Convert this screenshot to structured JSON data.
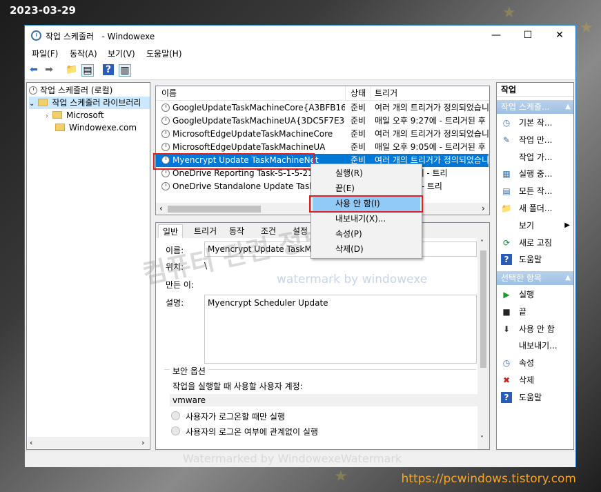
{
  "overlay": {
    "date": "2023-03-29",
    "url": "https://pcwindows.tistory.com"
  },
  "window": {
    "title": "작업 스케줄러",
    "subtitle": "- Windowexe",
    "minimize": "—",
    "maximize": "☐",
    "close": "✕"
  },
  "menu": [
    "파일(F)",
    "동작(A)",
    "보기(V)",
    "도움말(H)"
  ],
  "tree": {
    "root": "작업 스케줄러 (로컬)",
    "library": "작업 스케줄러 라이브러리",
    "children": [
      "Microsoft",
      "Windowexe.com"
    ]
  },
  "task_table": {
    "columns": [
      "이름",
      "상태",
      "트리거"
    ],
    "rows": [
      {
        "name": "GoogleUpdateTaskMachineCore{A3BFB16C-...",
        "status": "준비",
        "trigger": "여러 개의 트리거가 정의되었습니다."
      },
      {
        "name": "GoogleUpdateTaskMachineUA{3DC5F7E3-F4...",
        "status": "준비",
        "trigger": "매일 오후 9:27에 - 트리거된 후"
      },
      {
        "name": "MicrosoftEdgeUpdateTaskMachineCore",
        "status": "준비",
        "trigger": "여러 개의 트리거가 정의되었습니다."
      },
      {
        "name": "MicrosoftEdgeUpdateTaskMachineUA",
        "status": "준비",
        "trigger": "매일 오후 9:05에 - 트리거된 후"
      },
      {
        "name": "Myencrypt Update TaskMachineNet",
        "status": "준비",
        "trigger": "여러 개의 트리거가 정의되었습니다.",
        "selected": true
      },
      {
        "name": "OneDrive Reporting Task-S-1-5-21-3",
        "status": "준비",
        "trigger": "오후 10:02에 - 트리"
      },
      {
        "name": "OneDrive Standalone Update Task-S-",
        "status": "준비",
        "trigger": "오후 9:00에 - 트리"
      }
    ]
  },
  "context_menu": {
    "items": [
      "실행(R)",
      "끝(E)",
      "사용 안 함(I)",
      "내보내기(X)...",
      "속성(P)",
      "삭제(D)"
    ],
    "highlighted_index": 2
  },
  "detail": {
    "tabs": [
      "일반",
      "트리거",
      "동작",
      "조건",
      "설정"
    ],
    "name_label": "이름:",
    "name_value": "Myencrypt Update TaskMach",
    "location_label": "위치:",
    "location_value": "\\",
    "author_label": "만든 이:",
    "desc_label": "설명:",
    "desc_value": "Myencrypt Scheduler Update",
    "security_title": "보안 옵션",
    "account_label": "작업을 실행할 때 사용할 사용자 계정:",
    "account_value": "vmware",
    "radio1": "사용자가 로그온할 때만 실행",
    "radio2": "사용자의 로그온 여부에 관계없이 실행"
  },
  "actions": {
    "title": "작업",
    "section1": "작업 스케줄...",
    "items1": [
      {
        "icon": "clock-icon",
        "label": "기본 작..."
      },
      {
        "icon": "create-task-icon",
        "label": "작업 만..."
      },
      {
        "icon": "",
        "label": "작업 가..."
      },
      {
        "icon": "running-tasks-icon",
        "label": "실행 중..."
      },
      {
        "icon": "all-tasks-icon",
        "label": "모든 작..."
      },
      {
        "icon": "new-folder-icon",
        "label": "새 폴더..."
      },
      {
        "icon": "",
        "label": "보기"
      },
      {
        "icon": "refresh-icon",
        "label": "새로 고침"
      },
      {
        "icon": "help-icon",
        "label": "도움말"
      }
    ],
    "section2": "선택한 항목",
    "items2": [
      {
        "icon": "run-icon",
        "label": "실행"
      },
      {
        "icon": "end-icon",
        "label": "끝"
      },
      {
        "icon": "disable-icon",
        "label": "사용 안 함"
      },
      {
        "icon": "",
        "label": "내보내기..."
      },
      {
        "icon": "properties-icon",
        "label": "속성"
      },
      {
        "icon": "delete-icon",
        "label": "삭제"
      },
      {
        "icon": "help-icon",
        "label": "도움말"
      }
    ]
  },
  "watermarks": {
    "blue": "watermark by windowexe",
    "status": "Watermarked by WindowexeWatermark",
    "korean": "컴퓨터 관련 정보"
  },
  "colors": {
    "selection": "#0078d7",
    "accent_red": "#e02020",
    "url": "#f5a623"
  }
}
